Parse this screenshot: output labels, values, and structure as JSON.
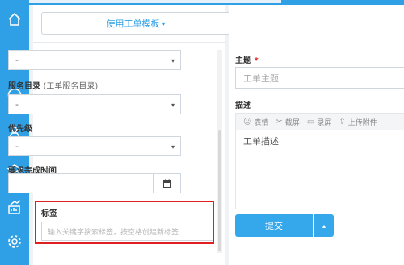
{
  "sidebar": {
    "icons": [
      "home-icon",
      "clipboard-icon",
      "chat-icon",
      "people-icon",
      "layers-icon",
      "chart-icon",
      "gear-icon"
    ]
  },
  "template": {
    "label": "使用工单模板",
    "caret": "▾"
  },
  "form_left": {
    "top_select": {
      "value": "-",
      "arrow": "▾"
    },
    "service_catalog": {
      "label": "服务目录",
      "hint": "(工单服务目录)",
      "value": "-",
      "arrow": "▾"
    },
    "priority": {
      "label": "优先级",
      "value": "-",
      "arrow": "▾"
    },
    "due_time": {
      "label": "要求完成时间",
      "value": ""
    },
    "tags": {
      "label": "标签",
      "placeholder": "输入关键字搜索标签，按空格创建新标签"
    }
  },
  "form_right": {
    "subject": {
      "label": "主题",
      "required_mark": "*",
      "placeholder": "工单主题"
    },
    "description": {
      "label": "描述",
      "toolbar": [
        {
          "icon": "emoji-icon",
          "glyph": "☺",
          "label": "表情"
        },
        {
          "icon": "scissors-icon",
          "glyph": "✂",
          "label": "截屏"
        },
        {
          "icon": "video-icon",
          "glyph": "▭",
          "label": "录屏"
        },
        {
          "icon": "upload-icon",
          "glyph": "⇪",
          "label": "上传附件"
        }
      ],
      "placeholder": "工单描述"
    },
    "submit": {
      "label": "提交",
      "dropdown": "▴"
    }
  },
  "colors": {
    "accent": "#2f9fe6",
    "button": "#35a8ec",
    "highlight_border": "#e02020"
  }
}
